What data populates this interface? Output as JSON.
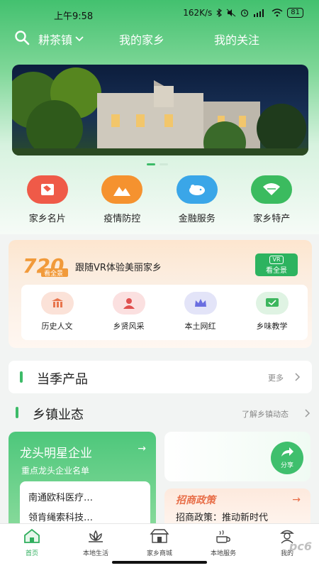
{
  "status_bar": {
    "time": "上午9:58",
    "network_speed": "162K/s",
    "battery": "81"
  },
  "top_nav": {
    "town": "耕茶镇",
    "tabs": [
      "我的家乡",
      "我的关注"
    ]
  },
  "quick_entries": [
    {
      "label": "家乡名片",
      "icon": "map-card-icon",
      "color": "#ef5a48"
    },
    {
      "label": "疫情防控",
      "icon": "mountain-icon",
      "color": "#f5922f"
    },
    {
      "label": "金融服务",
      "icon": "piggy-bank-icon",
      "color": "#3aa6e8"
    },
    {
      "label": "家乡特产",
      "icon": "fan-icon",
      "color": "#3bbb5f"
    }
  ],
  "vr": {
    "badge_number": "720",
    "badge_text": "看全景",
    "title": "跟随VR体验美丽家乡",
    "button_badge": "VR",
    "button_label": "看全景",
    "items": [
      {
        "label": "历史人文",
        "icon": "temple-icon",
        "bg": "#fbe2d8",
        "fg": "#e8754d"
      },
      {
        "label": "乡贤风采",
        "icon": "person-icon",
        "bg": "#fbe0e0",
        "fg": "#e0504f"
      },
      {
        "label": "本土网红",
        "icon": "crown-icon",
        "bg": "#e3e4f8",
        "fg": "#6a6ee0"
      },
      {
        "label": "乡味教学",
        "icon": "teach-icon",
        "bg": "#dff3e3",
        "fg": "#3cb65e"
      }
    ]
  },
  "seasonal": {
    "title": "当季产品",
    "more": "更多"
  },
  "business": {
    "title": "乡镇业态",
    "more": "了解乡镇动态"
  },
  "star_enterprise": {
    "title": "龙头明星企业",
    "subtitle": "重点龙头企业名单",
    "items": [
      "南通欧科医疗…",
      "领肯绳索科技…"
    ]
  },
  "share": {
    "label": "分享"
  },
  "policy": {
    "badge": "招商政策",
    "text": "招商政策：推动新时代"
  },
  "tab_bar": {
    "active": "首页",
    "items": [
      {
        "label": "首页",
        "icon": "home-icon"
      },
      {
        "label": "本地生活",
        "icon": "lotus-icon"
      },
      {
        "label": "家乡商城",
        "icon": "shop-icon"
      },
      {
        "label": "本地服务",
        "icon": "service-icon"
      },
      {
        "label": "我的",
        "icon": "profile-icon"
      }
    ]
  },
  "colors": {
    "brand_green": "#3dbb68",
    "accent_orange": "#e86e48"
  }
}
